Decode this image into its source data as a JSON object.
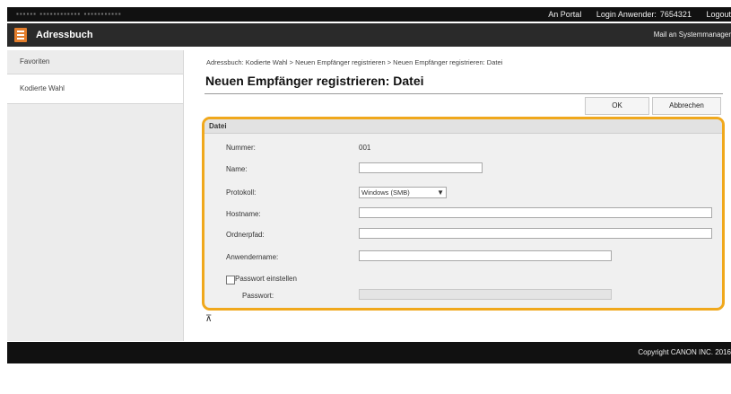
{
  "topbar": {
    "blurred_left": "▪▪▪▪▪▪ ▪▪▪▪▪▪▪▪▪▪▪▪ ▪▪▪▪▪▪▪▪▪▪▪",
    "portal_link": "An Portal",
    "login_label": "Login Anwender:",
    "login_user": "7654321",
    "logout_link": "Logout"
  },
  "app": {
    "title": "Adressbuch",
    "mail_admin_link": "Mail an Systemmanager"
  },
  "sidebar": {
    "items": [
      {
        "label": "Favoriten"
      },
      {
        "label": "Kodierte Wahl"
      }
    ]
  },
  "main": {
    "breadcrumb": "Adressbuch: Kodierte Wahl > Neuen Empfänger registrieren > Neuen Empfänger registrieren: Datei",
    "title": "Neuen Empfänger registrieren: Datei",
    "ok_label": "OK",
    "cancel_label": "Abbrechen"
  },
  "form": {
    "section_title": "Datei",
    "number_label": "Nummer:",
    "number_value": "001",
    "name_label": "Name:",
    "name_value": "",
    "protocol_label": "Protokoll:",
    "protocol_value": "Windows (SMB)",
    "hostname_label": "Hostname:",
    "hostname_value": "",
    "folder_label": "Ordnerpfad:",
    "folder_value": "",
    "username_label": "Anwendername:",
    "username_value": "",
    "set_password_label": "Passwort einstellen",
    "set_password_checked": false,
    "password_label": "Passwort:",
    "password_value": ""
  },
  "to_top_icon": "to-top-icon",
  "footer": {
    "copyright": "Copyright CANON INC. 2016"
  },
  "colors": {
    "accent": "#f0a81c",
    "app_icon": "#e37d2b",
    "topbar": "#111111"
  }
}
